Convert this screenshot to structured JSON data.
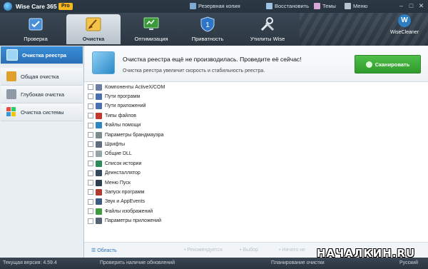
{
  "titlebar": {
    "app_name": "Wise Care 365",
    "badge": "Pro",
    "menu": [
      {
        "label": "Резервная копия",
        "icon": "backup-icon"
      },
      {
        "label": "Восстановить",
        "icon": "restore-icon"
      },
      {
        "label": "Темы",
        "icon": "theme-icon"
      },
      {
        "label": "Меню",
        "icon": "menu-icon"
      }
    ]
  },
  "nav": {
    "tabs": [
      {
        "label": "Проверка",
        "icon": "check-icon"
      },
      {
        "label": "Очистка",
        "icon": "broom-icon"
      },
      {
        "label": "Оптимизация",
        "icon": "monitor-icon"
      },
      {
        "label": "Приватность",
        "icon": "shield-icon"
      },
      {
        "label": "Утилиты Wise",
        "icon": "tools-icon"
      }
    ],
    "active_index": 1,
    "brand_mark": "W",
    "brand": "WiseCleaner"
  },
  "sidebar": {
    "items": [
      {
        "label": "Очистка реестра",
        "icon": "registry-icon",
        "active": true
      },
      {
        "label": "Общая очистка",
        "icon": "broom-icon",
        "active": false
      },
      {
        "label": "Глубокая очистка",
        "icon": "deep-clean-icon",
        "active": false
      },
      {
        "label": "Очистка системы",
        "icon": "windows-icon",
        "active": false
      }
    ]
  },
  "banner": {
    "title": "Очистка реестра ещё не производилась. Проведите её сейчас!",
    "subtitle": "Очистка реестра увеличит скорость и стабильность реестра.",
    "scan_button": "Сканировать"
  },
  "registry_items": [
    {
      "label": "Компоненты ActiveX/COM",
      "color": "#6b7fa3"
    },
    {
      "label": "Пути программ",
      "color": "#4a6fb0"
    },
    {
      "label": "Пути приложений",
      "color": "#4a6fb0"
    },
    {
      "label": "Типы файлов",
      "color": "#c0392b"
    },
    {
      "label": "Файлы помощи",
      "color": "#2e86c1"
    },
    {
      "label": "Параметры брандмауэра",
      "color": "#7f8c8d"
    },
    {
      "label": "Шрифты",
      "color": "#5d6d7e"
    },
    {
      "label": "Общие DLL",
      "color": "#95a5a6"
    },
    {
      "label": "Список истории",
      "color": "#2e8b57"
    },
    {
      "label": "Деинсталлятор",
      "color": "#34495e"
    },
    {
      "label": "Меню Пуск",
      "color": "#2c3e50"
    },
    {
      "label": "Запуск программ",
      "color": "#b03a2e"
    },
    {
      "label": "Звук и AppEvents",
      "color": "#3d5a80"
    },
    {
      "label": "Файлы изображений",
      "color": "#3f9b3f"
    },
    {
      "label": "Параметры приложений",
      "color": "#566573"
    }
  ],
  "footer": {
    "scope": "Область",
    "items": [
      "Рекомендуется",
      "Выбор",
      "Ничего не"
    ]
  },
  "status": {
    "left": "Текущая версия: 4.59.4",
    "check_updates": "Проверить наличие обновлений",
    "planner": "Планирование очистки",
    "right": "Русский"
  },
  "watermark": "НАЧАЛКИН.RU",
  "colors": {
    "accent": "#2a6fb8",
    "scan_green": "#3aa635",
    "titlebar": "#2c3945"
  }
}
